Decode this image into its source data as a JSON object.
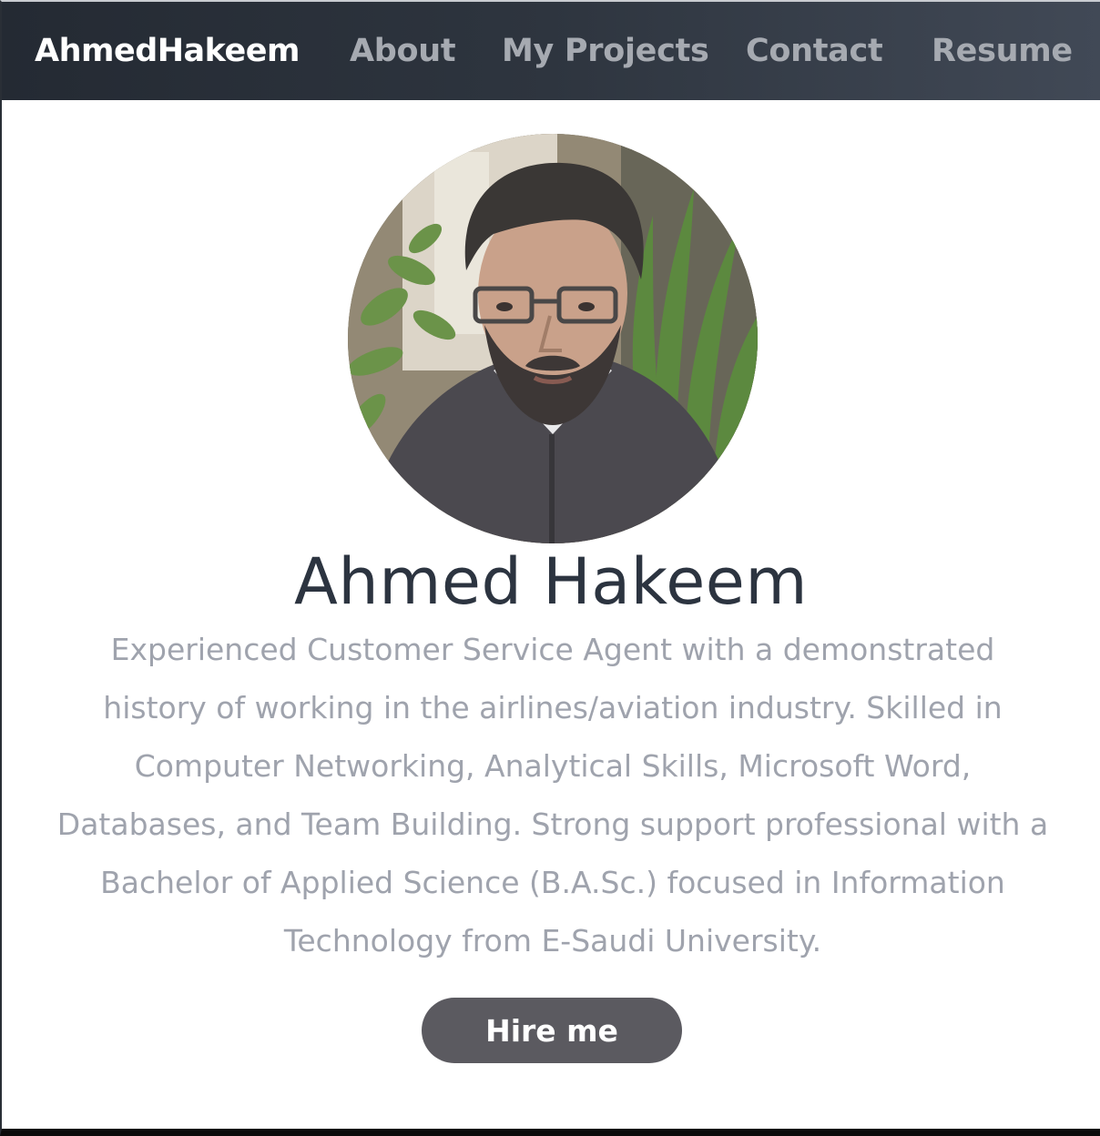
{
  "nav": {
    "brand": "AhmedHakeem",
    "links": [
      {
        "label": "About"
      },
      {
        "label": "My Projects"
      },
      {
        "label": "Contact"
      },
      {
        "label": "Resume"
      }
    ]
  },
  "hero": {
    "name": "Ahmed Hakeem",
    "bio": "Experienced Customer Service Agent with a demonstrated history of working in the airlines/aviation industry. Skilled in Computer Networking, Analytical Skills, Microsoft Word, Databases, and Team Building. Strong support professional with a Bachelor of Applied Science (B.A.Sc.) focused in Information Technology from E-Saudi University.",
    "cta_label": "Hire me",
    "avatar_icon": "profile-photo"
  },
  "colors": {
    "nav_bg": "#2e353f",
    "brand": "#ffffff",
    "nav_link": "#a6aab1",
    "name": "#2c3440",
    "bio": "#9fa3ad",
    "cta_bg": "#5b5a60"
  }
}
